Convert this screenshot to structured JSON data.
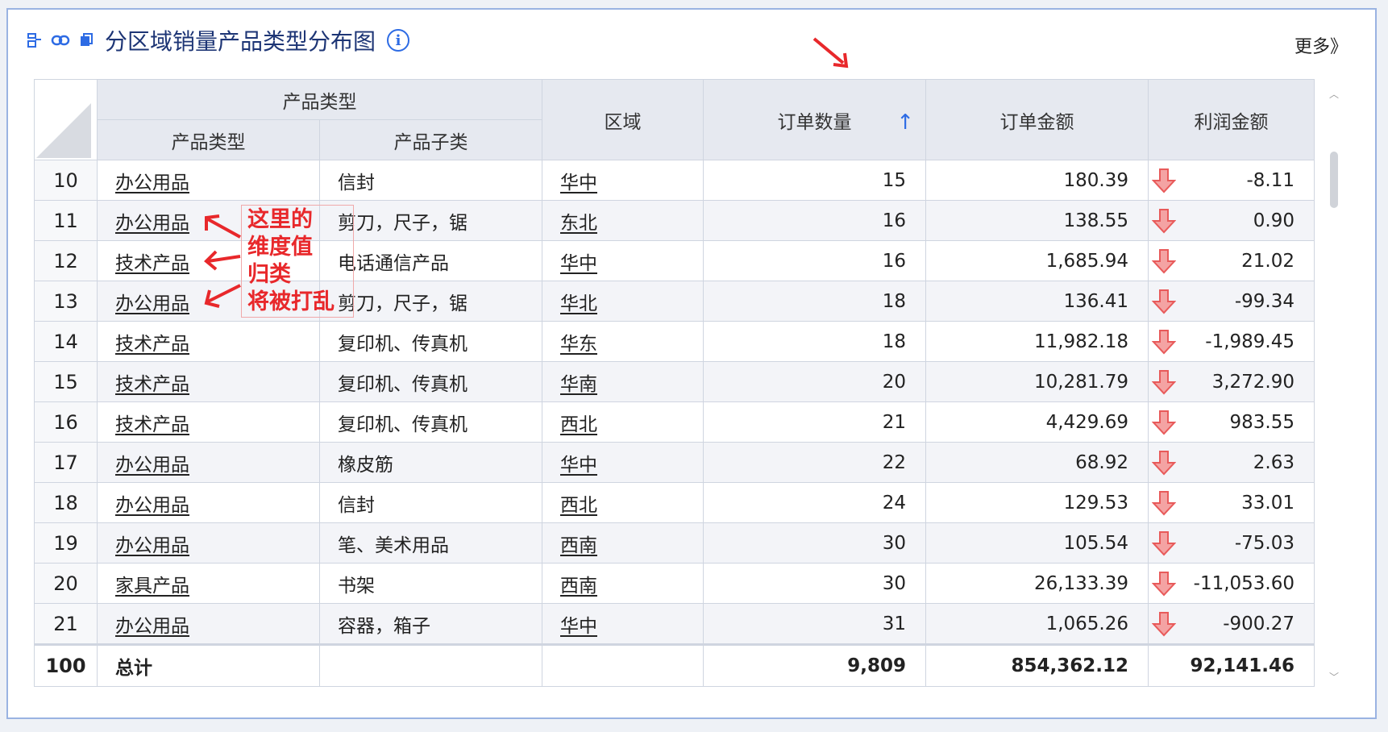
{
  "header": {
    "title": "分区域销量产品类型分布图",
    "more_label": "更多》"
  },
  "columns": {
    "group_label": "产品类型",
    "product_type": "产品类型",
    "product_sub": "产品子类",
    "region": "区域",
    "order_qty": "订单数量",
    "order_amount": "订单金额",
    "profit": "利润金额"
  },
  "rows": [
    {
      "idx": "10",
      "type": "办公用品",
      "sub": "信封",
      "region": "华中",
      "qty": "15",
      "amount": "180.39",
      "profit": "-8.11"
    },
    {
      "idx": "11",
      "type": "办公用品",
      "sub": "剪刀，尺子，锯",
      "region": "东北",
      "qty": "16",
      "amount": "138.55",
      "profit": "0.90"
    },
    {
      "idx": "12",
      "type": "技术产品",
      "sub": "电话通信产品",
      "region": "华中",
      "qty": "16",
      "amount": "1,685.94",
      "profit": "21.02"
    },
    {
      "idx": "13",
      "type": "办公用品",
      "sub": "剪刀，尺子，锯",
      "region": "华北",
      "qty": "18",
      "amount": "136.41",
      "profit": "-99.34"
    },
    {
      "idx": "14",
      "type": "技术产品",
      "sub": "复印机、传真机",
      "region": "华东",
      "qty": "18",
      "amount": "11,982.18",
      "profit": "-1,989.45"
    },
    {
      "idx": "15",
      "type": "技术产品",
      "sub": "复印机、传真机",
      "region": "华南",
      "qty": "20",
      "amount": "10,281.79",
      "profit": "3,272.90"
    },
    {
      "idx": "16",
      "type": "技术产品",
      "sub": "复印机、传真机",
      "region": "西北",
      "qty": "21",
      "amount": "4,429.69",
      "profit": "983.55"
    },
    {
      "idx": "17",
      "type": "办公用品",
      "sub": "橡皮筋",
      "region": "华中",
      "qty": "22",
      "amount": "68.92",
      "profit": "2.63"
    },
    {
      "idx": "18",
      "type": "办公用品",
      "sub": "信封",
      "region": "西北",
      "qty": "24",
      "amount": "129.53",
      "profit": "33.01"
    },
    {
      "idx": "19",
      "type": "办公用品",
      "sub": "笔、美术用品",
      "region": "西南",
      "qty": "30",
      "amount": "105.54",
      "profit": "-75.03"
    },
    {
      "idx": "20",
      "type": "家具产品",
      "sub": "书架",
      "region": "西南",
      "qty": "30",
      "amount": "26,133.39",
      "profit": "-11,053.60"
    },
    {
      "idx": "21",
      "type": "办公用品",
      "sub": "容器，箱子",
      "region": "华中",
      "qty": "31",
      "amount": "1,065.26",
      "profit": "-900.27"
    }
  ],
  "total": {
    "idx": "100",
    "label": "总计",
    "qty": "9,809",
    "amount": "854,362.12",
    "profit": "92,141.46"
  },
  "annotation": {
    "lines": [
      "这里的",
      "维度值",
      "归类",
      "将被打乱"
    ]
  },
  "colors": {
    "accent": "#2d6be4",
    "annotation": "#e8282b",
    "profit_arrow": "#e85a5a"
  }
}
